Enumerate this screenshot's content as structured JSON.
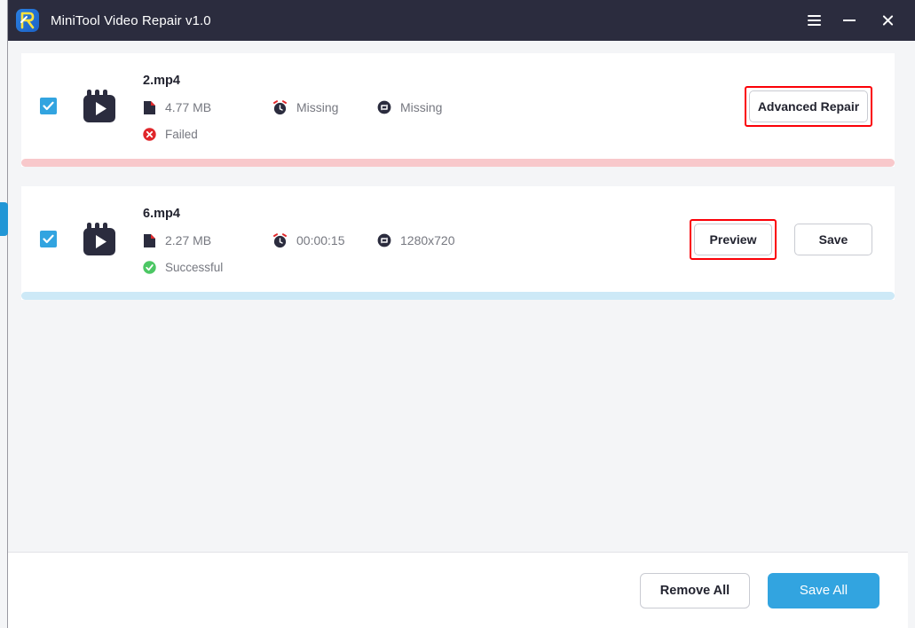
{
  "window": {
    "title": "MiniTool Video Repair v1.0",
    "logo_icon": "minitool-r-logo",
    "controls": {
      "menu_icon": "hamburger-menu-icon",
      "minimize_icon": "minimize-icon",
      "close_icon": "close-icon"
    }
  },
  "colors": {
    "titlebar": "#2b2c3e",
    "accent": "#32a4e0",
    "background": "#f4f5f7",
    "card": "#ffffff",
    "failed": "#e0272b",
    "success": "#4cc764",
    "progress_failed": "#f8c8cb",
    "progress_success": "#cde9f7",
    "highlight": "#fb0007"
  },
  "files": [
    {
      "name": "2.mp4",
      "checked": true,
      "thumbnail_icon": "video-clapper-icon",
      "size": {
        "icon": "file-icon",
        "value": "4.77 MB"
      },
      "duration": {
        "icon": "clock-icon",
        "value": "Missing"
      },
      "resolution": {
        "icon": "resolution-icon",
        "value": "Missing"
      },
      "status": {
        "icon": "error-icon",
        "label": "Failed",
        "state": "failed"
      },
      "progress": {
        "percent": 100,
        "color": "#f8c8cb"
      },
      "actions": [
        {
          "label": "Advanced Repair",
          "name": "advanced-repair-button",
          "style": "outline",
          "highlighted": true
        }
      ]
    },
    {
      "name": "6.mp4",
      "checked": true,
      "thumbnail_icon": "video-clapper-icon",
      "size": {
        "icon": "file-icon",
        "value": "2.27 MB"
      },
      "duration": {
        "icon": "clock-icon",
        "value": "00:00:15"
      },
      "resolution": {
        "icon": "resolution-icon",
        "value": "1280x720"
      },
      "status": {
        "icon": "success-icon",
        "label": "Successful",
        "state": "successful"
      },
      "progress": {
        "percent": 100,
        "color": "#cde9f7"
      },
      "actions": [
        {
          "label": "Preview",
          "name": "preview-button",
          "style": "outline",
          "highlighted": true
        },
        {
          "label": "Save",
          "name": "save-button",
          "style": "outline",
          "highlighted": false
        }
      ]
    }
  ],
  "footer": {
    "remove_all_label": "Remove All",
    "save_all_label": "Save All"
  }
}
